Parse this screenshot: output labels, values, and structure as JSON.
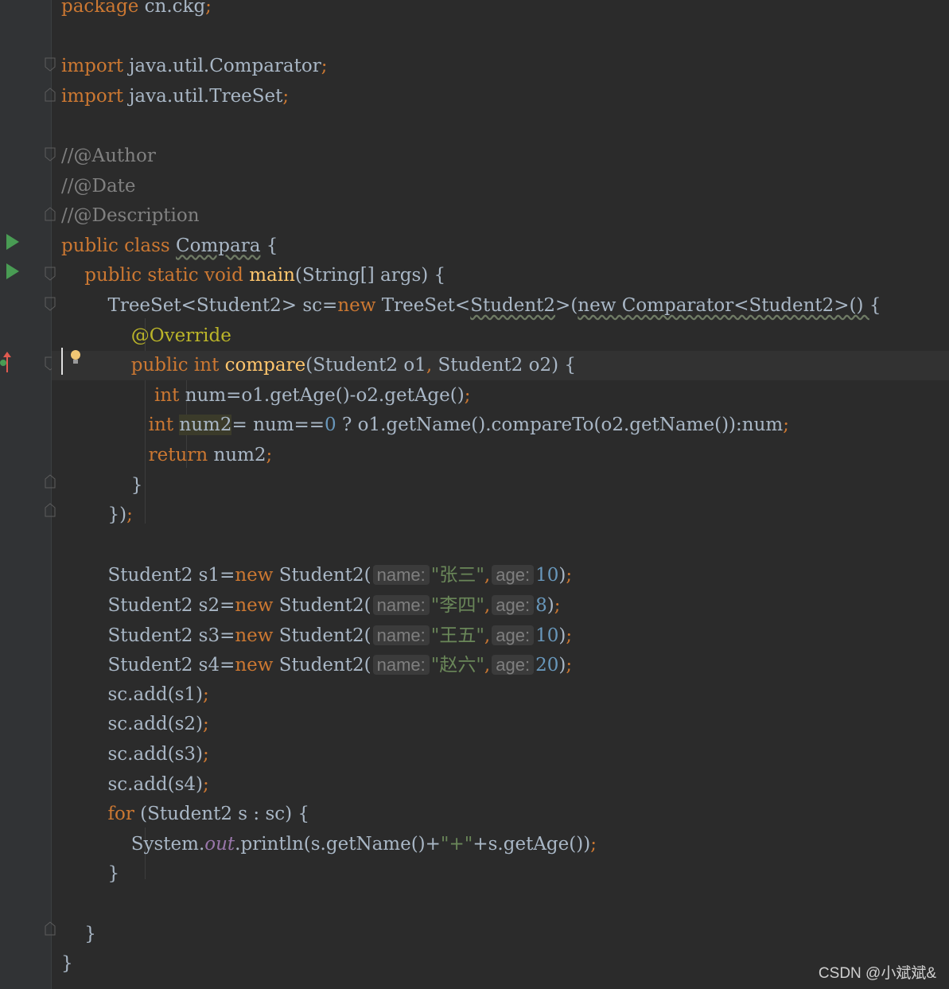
{
  "editor": {
    "language": "java",
    "current_line_index": 12,
    "lines": [
      [
        [
          "kw",
          "package"
        ],
        [
          "t",
          " cn.ckg"
        ],
        [
          "punct",
          ";"
        ]
      ],
      [],
      [
        [
          "kw",
          "import"
        ],
        [
          "t",
          " java.util.Comparator"
        ],
        [
          "punct",
          ";"
        ]
      ],
      [
        [
          "kw",
          "import"
        ],
        [
          "t",
          " java.util.TreeSet"
        ],
        [
          "punct",
          ";"
        ]
      ],
      [],
      [
        [
          "cm",
          "//@Author"
        ]
      ],
      [
        [
          "cm",
          "//@Date"
        ]
      ],
      [
        [
          "cm",
          "//@Description"
        ]
      ],
      [
        [
          "kw",
          "public class "
        ],
        [
          "wavy",
          "Compara"
        ],
        [
          "t",
          " {"
        ]
      ],
      [
        [
          "t",
          "    "
        ],
        [
          "kw",
          "public static void "
        ],
        [
          "fn",
          "main"
        ],
        [
          "t",
          "(String[] args) {"
        ]
      ],
      [
        [
          "t",
          "        TreeSet<Student2> sc="
        ],
        [
          "kw",
          "new"
        ],
        [
          "t",
          " TreeSet<"
        ],
        [
          "wavy",
          "Student2"
        ],
        [
          "t",
          ">("
        ],
        [
          "wavy",
          "new Comparator<Student2>() "
        ],
        [
          "t",
          "{"
        ]
      ],
      [
        [
          "t",
          "            "
        ],
        [
          "ann",
          "@Override"
        ]
      ],
      [
        [
          "t",
          "            "
        ],
        [
          "kw",
          "public int "
        ],
        [
          "fn",
          "compare"
        ],
        [
          "t",
          "(Student2 o1"
        ],
        [
          "punct",
          ","
        ],
        [
          "t",
          " Student2 o2) {"
        ]
      ],
      [
        [
          "t",
          "                "
        ],
        [
          "kw",
          "int"
        ],
        [
          "t",
          " num=o1.getAge()-o2.getAge()"
        ],
        [
          "punct",
          ";"
        ]
      ],
      [
        [
          "t",
          "               "
        ],
        [
          "kw",
          "int "
        ],
        [
          "hl",
          "num2"
        ],
        [
          "t",
          "= num=="
        ],
        [
          "num",
          "0"
        ],
        [
          "t",
          " ? o1.getName().compareTo(o2.getName()):num"
        ],
        [
          "punct",
          ";"
        ]
      ],
      [
        [
          "t",
          "               "
        ],
        [
          "kw",
          "return"
        ],
        [
          "t",
          " num2"
        ],
        [
          "punct",
          ";"
        ]
      ],
      [
        [
          "t",
          "            }"
        ]
      ],
      [
        [
          "t",
          "        })"
        ],
        [
          "punct",
          ";"
        ]
      ],
      [],
      [
        [
          "t",
          "        Student2 s1="
        ],
        [
          "kw",
          "new"
        ],
        [
          "t",
          " Student2("
        ],
        [
          "hint",
          "name:"
        ],
        [
          "str",
          "\"张三\""
        ],
        [
          "punct",
          ","
        ],
        [
          "hint",
          "age:"
        ],
        [
          "num",
          "10"
        ],
        [
          "t",
          ")"
        ],
        [
          "punct",
          ";"
        ]
      ],
      [
        [
          "t",
          "        Student2 s2="
        ],
        [
          "kw",
          "new"
        ],
        [
          "t",
          " Student2("
        ],
        [
          "hint",
          "name:"
        ],
        [
          "str",
          "\"李四\""
        ],
        [
          "punct",
          ","
        ],
        [
          "hint",
          "age:"
        ],
        [
          "num",
          "8"
        ],
        [
          "t",
          ")"
        ],
        [
          "punct",
          ";"
        ]
      ],
      [
        [
          "t",
          "        Student2 s3="
        ],
        [
          "kw",
          "new"
        ],
        [
          "t",
          " Student2("
        ],
        [
          "hint",
          "name:"
        ],
        [
          "str",
          "\"王五\""
        ],
        [
          "punct",
          ","
        ],
        [
          "hint",
          "age:"
        ],
        [
          "num",
          "10"
        ],
        [
          "t",
          ")"
        ],
        [
          "punct",
          ";"
        ]
      ],
      [
        [
          "t",
          "        Student2 s4="
        ],
        [
          "kw",
          "new"
        ],
        [
          "t",
          " Student2("
        ],
        [
          "hint",
          "name:"
        ],
        [
          "str",
          "\"赵六\""
        ],
        [
          "punct",
          ","
        ],
        [
          "hint",
          "age:"
        ],
        [
          "num",
          "20"
        ],
        [
          "t",
          ")"
        ],
        [
          "punct",
          ";"
        ]
      ],
      [
        [
          "t",
          "        sc.add(s1)"
        ],
        [
          "punct",
          ";"
        ]
      ],
      [
        [
          "t",
          "        sc.add(s2)"
        ],
        [
          "punct",
          ";"
        ]
      ],
      [
        [
          "t",
          "        sc.add(s3)"
        ],
        [
          "punct",
          ";"
        ]
      ],
      [
        [
          "t",
          "        sc.add(s4)"
        ],
        [
          "punct",
          ";"
        ]
      ],
      [
        [
          "t",
          "        "
        ],
        [
          "kw",
          "for"
        ],
        [
          "t",
          " (Student2 s : sc) {"
        ]
      ],
      [
        [
          "t",
          "            System."
        ],
        [
          "stat",
          "out"
        ],
        [
          "t",
          ".println(s.getName()+"
        ],
        [
          "str",
          "\"+\""
        ],
        [
          "t",
          "+s.getAge())"
        ],
        [
          "punct",
          ";"
        ]
      ],
      [
        [
          "t",
          "        }"
        ]
      ],
      [],
      [
        [
          "t",
          "    }"
        ]
      ],
      [
        [
          "t",
          "}"
        ]
      ]
    ]
  },
  "gutter": {
    "run_icons": [
      "run-class-icon",
      "run-main-icon"
    ],
    "override_marker": "override-implements-icon"
  },
  "watermark": "CSDN @小斌斌&",
  "colors": {
    "background": "#2b2b2b",
    "keyword": "#cc7832",
    "string": "#6a8759",
    "number": "#6897bb",
    "comment": "#808080",
    "method": "#ffc66d",
    "annotation": "#bbb529"
  }
}
